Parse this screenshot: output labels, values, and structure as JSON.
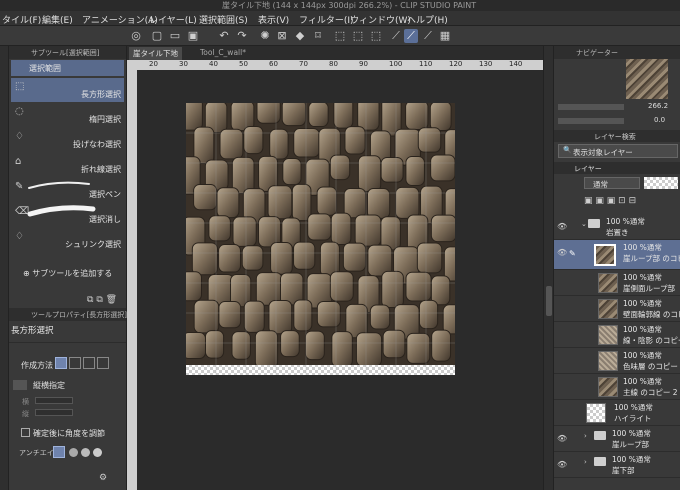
{
  "window": {
    "title": "崖タイル下地 (144 x 144px 300dpi 266.2%) - CLIP STUDIO PAINT"
  },
  "menu": [
    "タイル(F)",
    "編集(E)",
    "アニメーション(A)",
    "レイヤー(L)",
    "選択範囲(S)",
    "表示(V)",
    "フィルター(I)",
    "ウィンドウ(W)",
    "ヘルプ(H)"
  ],
  "subtool_panel": {
    "title": "サブツール[選択範囲]",
    "group_tab": "選択範囲",
    "items": [
      {
        "label": "長方形選択",
        "icon": "rect-select-icon",
        "selected": true
      },
      {
        "label": "楕円選択",
        "icon": "ellipse-select-icon",
        "selected": false
      },
      {
        "label": "投げなわ選択",
        "icon": "lasso-icon",
        "selected": false
      },
      {
        "label": "折れ線選択",
        "icon": "polyline-icon",
        "selected": false
      },
      {
        "label": "選択ペン",
        "icon": "select-pen-icon",
        "selected": false
      },
      {
        "label": "選択消し",
        "icon": "select-eraser-icon",
        "selected": false
      },
      {
        "label": "シュリンク選択",
        "icon": "shrink-select-icon",
        "selected": false
      }
    ],
    "add_subtool_label": "サブツールを追加する"
  },
  "tool_property": {
    "title": "ツールプロパティ[長方形選択]",
    "tool_name": "長方形選択",
    "creation_method_label": "作成方法",
    "aspect_label": "縦横指定",
    "width_label": "横",
    "height_label": "縦",
    "adjust_angle_label": "確定後に角度を調節",
    "antialias_label": "アンチエイ"
  },
  "canvas": {
    "tabs": [
      {
        "label": "崖タイル下地",
        "active": true
      },
      {
        "label": "Tool_C_wall*",
        "active": false
      }
    ],
    "ruler_ticks": [
      "20",
      "30",
      "40",
      "50",
      "60",
      "70",
      "80",
      "90",
      "100",
      "110",
      "120",
      "130",
      "140"
    ]
  },
  "navigator": {
    "title": "ナビゲーター",
    "zoom": "266.2",
    "rotation": "0.0"
  },
  "layer_panel": {
    "search_tab": "レイヤー検索",
    "layer_tab": "レイヤー",
    "filter_label": "表示対象レイヤー",
    "blend_mode": "通常",
    "layers": [
      {
        "opacity": "100 %通常",
        "name": "岩置き",
        "type": "folder",
        "selected": false,
        "visible": true,
        "expanded": true
      },
      {
        "opacity": "100 %通常",
        "name": "崖ループ部 のコピー",
        "type": "raster",
        "selected": true,
        "visible": true
      },
      {
        "opacity": "100 %通常",
        "name": "崖側面ループ部",
        "type": "raster",
        "selected": false,
        "visible": false
      },
      {
        "opacity": "100 %通常",
        "name": "壁面輪郭線 のコピー",
        "type": "raster",
        "selected": false,
        "visible": false
      },
      {
        "opacity": "100 %通常",
        "name": "線・陰影 のコピー",
        "type": "raster",
        "selected": false,
        "visible": false
      },
      {
        "opacity": "100 %通常",
        "name": "色味層 のコピー",
        "type": "raster",
        "selected": false,
        "visible": false
      },
      {
        "opacity": "100 %通常",
        "name": "主線 のコピー 2",
        "type": "raster",
        "selected": false,
        "visible": false
      },
      {
        "opacity": "100 %通常",
        "name": "ハイライト",
        "type": "raster",
        "selected": false,
        "visible": false
      },
      {
        "opacity": "100 %通常",
        "name": "崖ループ部",
        "type": "folder",
        "selected": false,
        "visible": true
      },
      {
        "opacity": "100 %通常",
        "name": "崖下部",
        "type": "folder",
        "selected": false,
        "visible": true
      }
    ]
  }
}
